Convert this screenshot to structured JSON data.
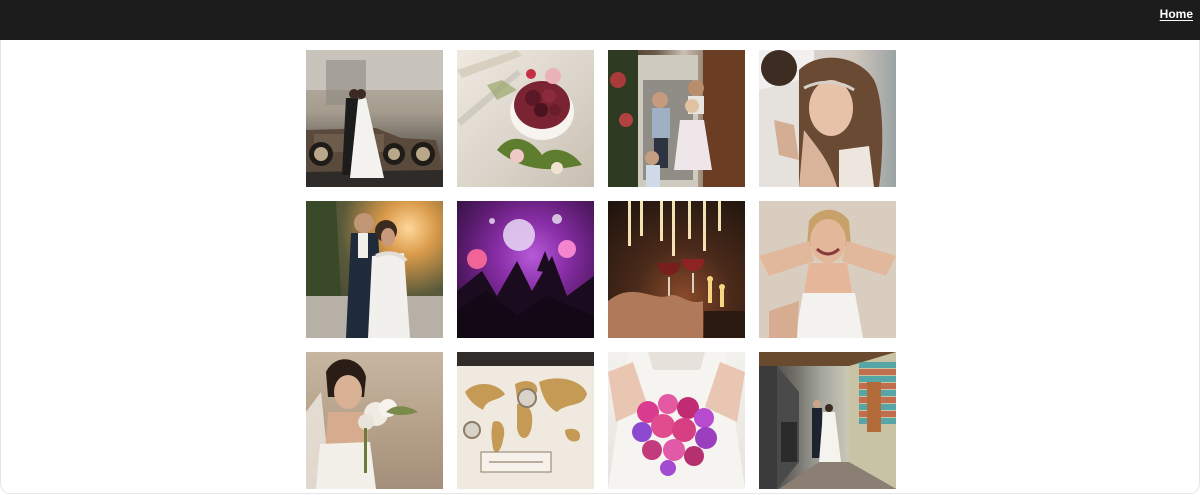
{
  "nav": {
    "home_label": "Home"
  },
  "colors": {
    "topbar": "#1c1c1c",
    "page_bg": "#ffffff",
    "home_text": "#ffffff"
  },
  "gallery": {
    "columns": 4,
    "tiles": [
      {
        "subject": "couple-with-vintage-car"
      },
      {
        "subject": "wedding-cake-with-berries"
      },
      {
        "subject": "children-in-doorway"
      },
      {
        "subject": "bride-with-hair-accessory"
      },
      {
        "subject": "couple-at-sunset"
      },
      {
        "subject": "party-lights-dancefloor"
      },
      {
        "subject": "candlelit-toast"
      },
      {
        "subject": "laughing-bride"
      },
      {
        "subject": "bride-with-bouquet"
      },
      {
        "subject": "world-map-guestbook"
      },
      {
        "subject": "pink-purple-bouquet"
      },
      {
        "subject": "couple-in-corridor"
      }
    ]
  }
}
